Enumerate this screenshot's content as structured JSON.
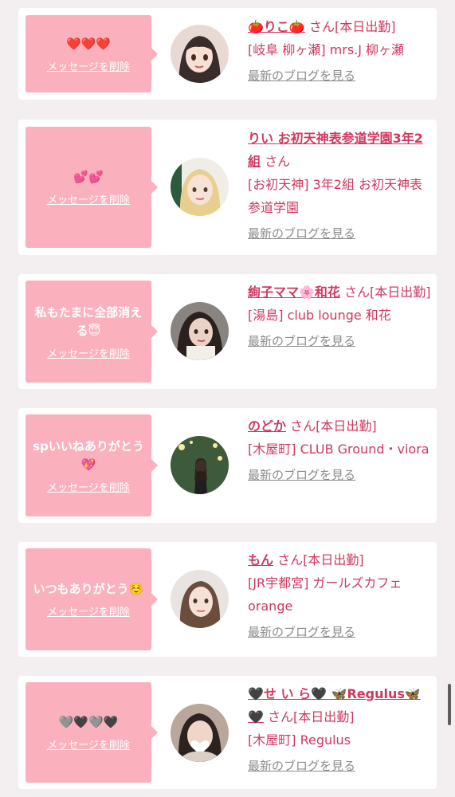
{
  "colors": {
    "accent": "#d0385f",
    "bubble": "#fbb1bd",
    "blog_link": "#8b8b8b",
    "background": "#f3eff0"
  },
  "delete_label": "メッセージを削除",
  "blog_label": "最新のブログを見る",
  "messages": [
    {
      "message": "❤️❤️❤️",
      "name": "🍅りこ🍅",
      "suffix": "さん[本日出勤]",
      "shop": "[岐阜 柳ヶ瀬] mrs.J 柳ヶ瀬"
    },
    {
      "message": "💕💕",
      "name": "りい お初天神表参道学園3年2組",
      "suffix": "さん",
      "shop": "[お初天神] 3年2組 お初天神表参道学園"
    },
    {
      "message": "私もたまに全部消える😇",
      "name": "絢子ママ🌸和花",
      "suffix": "さん[本日出勤]",
      "shop": "[湯島] club lounge 和花"
    },
    {
      "message": "spいいねありがとう💖",
      "name": "のどか",
      "suffix": "さん[本日出勤]",
      "shop": "[木屋町] CLUB Ground・viora"
    },
    {
      "message": "いつもありがとう☺️",
      "name": "もん",
      "suffix": "さん[本日出勤]",
      "shop": "[JR宇都宮] ガールズカフェ orange"
    },
    {
      "message": "🩶🖤🩶🖤",
      "name": "🖤せ い ら🖤 🦋Regulus🦋🖤",
      "suffix": "さん[本日出勤]",
      "shop": "[木屋町] Regulus"
    }
  ]
}
